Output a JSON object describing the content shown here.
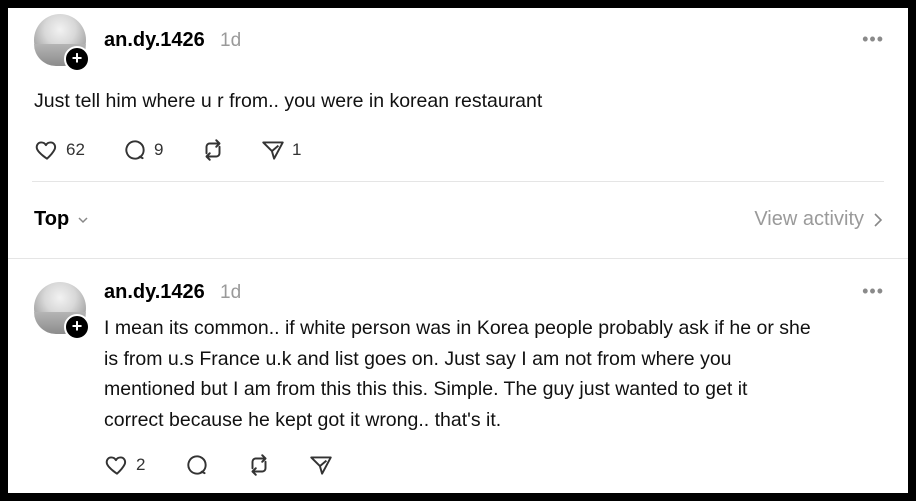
{
  "post": {
    "username": "an.dy.1426",
    "time": "1d",
    "text": "Just tell him where u r from.. you were in korean restaurant",
    "likes": "62",
    "comments": "9",
    "reposts": "",
    "shares": "1"
  },
  "sort": {
    "label": "Top"
  },
  "activity": {
    "label": "View activity"
  },
  "reply": {
    "username": "an.dy.1426",
    "time": "1d",
    "lines": [
      "I mean its common.. if white person was in Korea people probably ask if he or she",
      "is from u.s France u.k and list goes on. Just say I am not from where you",
      "mentioned but I am from this this this. Simple. The guy just wanted to get it",
      "correct because he kept got it wrong.. that's it."
    ],
    "likes": "2"
  },
  "icons": [
    "plus-icon",
    "more-icon",
    "heart-icon",
    "comment-icon",
    "repost-icon",
    "share-icon",
    "chevron-down-icon",
    "chevron-right-icon"
  ]
}
